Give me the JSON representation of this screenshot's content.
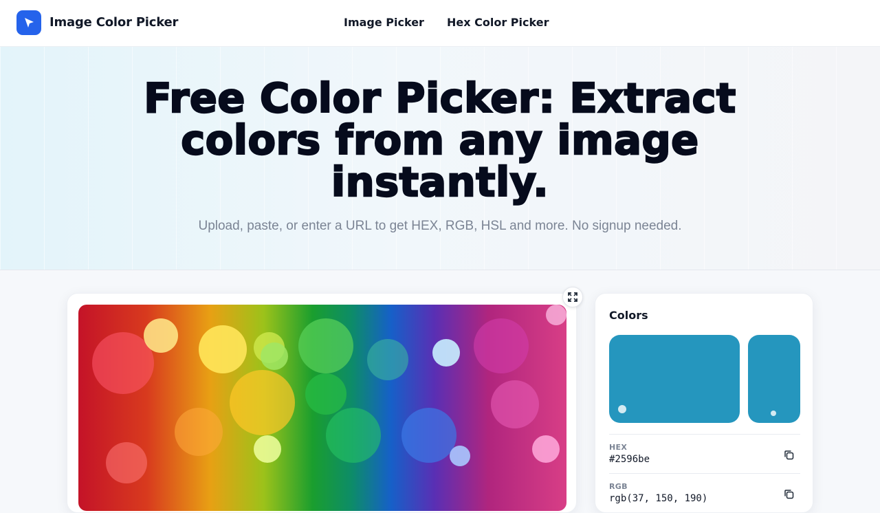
{
  "header": {
    "brand": "Image Color Picker",
    "logo_icon": "cursor-arrow-icon",
    "nav": [
      {
        "label": "Image Picker"
      },
      {
        "label": "Hex Color Picker"
      }
    ]
  },
  "hero": {
    "title_lines": [
      "Free Color Picker: Extract",
      "colors from any image",
      "instantly."
    ],
    "subtitle": "Upload, paste, or enter a URL to get HEX, RGB, HSL and more. No signup needed."
  },
  "image_panel": {
    "expand_icon": "expand-arrows-icon"
  },
  "colors_panel": {
    "title": "Colors",
    "selected_color": "#2596be",
    "rows": [
      {
        "label": "HEX",
        "value": "#2596be"
      },
      {
        "label": "RGB",
        "value": "rgb(37, 150, 190)"
      }
    ],
    "copy_icon": "copy-icon"
  },
  "colors": {
    "brand": "#2563eb",
    "swatch": "#2596be"
  }
}
